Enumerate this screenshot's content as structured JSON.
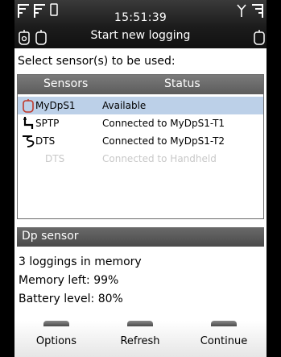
{
  "status_bar": {
    "time": "15:51:39",
    "title": "Start new logging",
    "icons": [
      "signal-strength-icon",
      "card-icon",
      "sensor-tube-icon",
      "sensor-tube-icon",
      "antenna-icon",
      "signal-strength-icon",
      "sensor-tube-icon"
    ]
  },
  "prompt": "Select sensor(s) to be used:",
  "table": {
    "columns": {
      "sensors": "Sensors",
      "status": "Status"
    },
    "rows": [
      {
        "icon": "dp-sensor-icon",
        "name": "MyDpS1",
        "status": "Available",
        "selected": true,
        "disabled": false
      },
      {
        "icon": "sptp-probe-icon",
        "name": "SPTP",
        "status": "Connected to MyDpS1-T1",
        "selected": false,
        "disabled": false
      },
      {
        "icon": "dts-probe-icon",
        "name": "DTS",
        "status": "Connected to MyDpS1-T2",
        "selected": false,
        "disabled": false
      },
      {
        "icon": "",
        "name": "DTS",
        "status": "Connected to Handheld",
        "selected": false,
        "disabled": true
      }
    ]
  },
  "info": {
    "header": "Dp sensor",
    "lines": [
      "3 loggings in memory",
      "Memory left: 99%",
      "Battery level: 80%"
    ]
  },
  "softkeys": {
    "left": "Options",
    "center": "Refresh",
    "right": "Continue"
  },
  "colors": {
    "selected_row": "#bcd0e8",
    "header_bg": "#5c5c5c",
    "status_bar_bg": "#1c1c1c",
    "dp_icon": "#c0392b"
  }
}
